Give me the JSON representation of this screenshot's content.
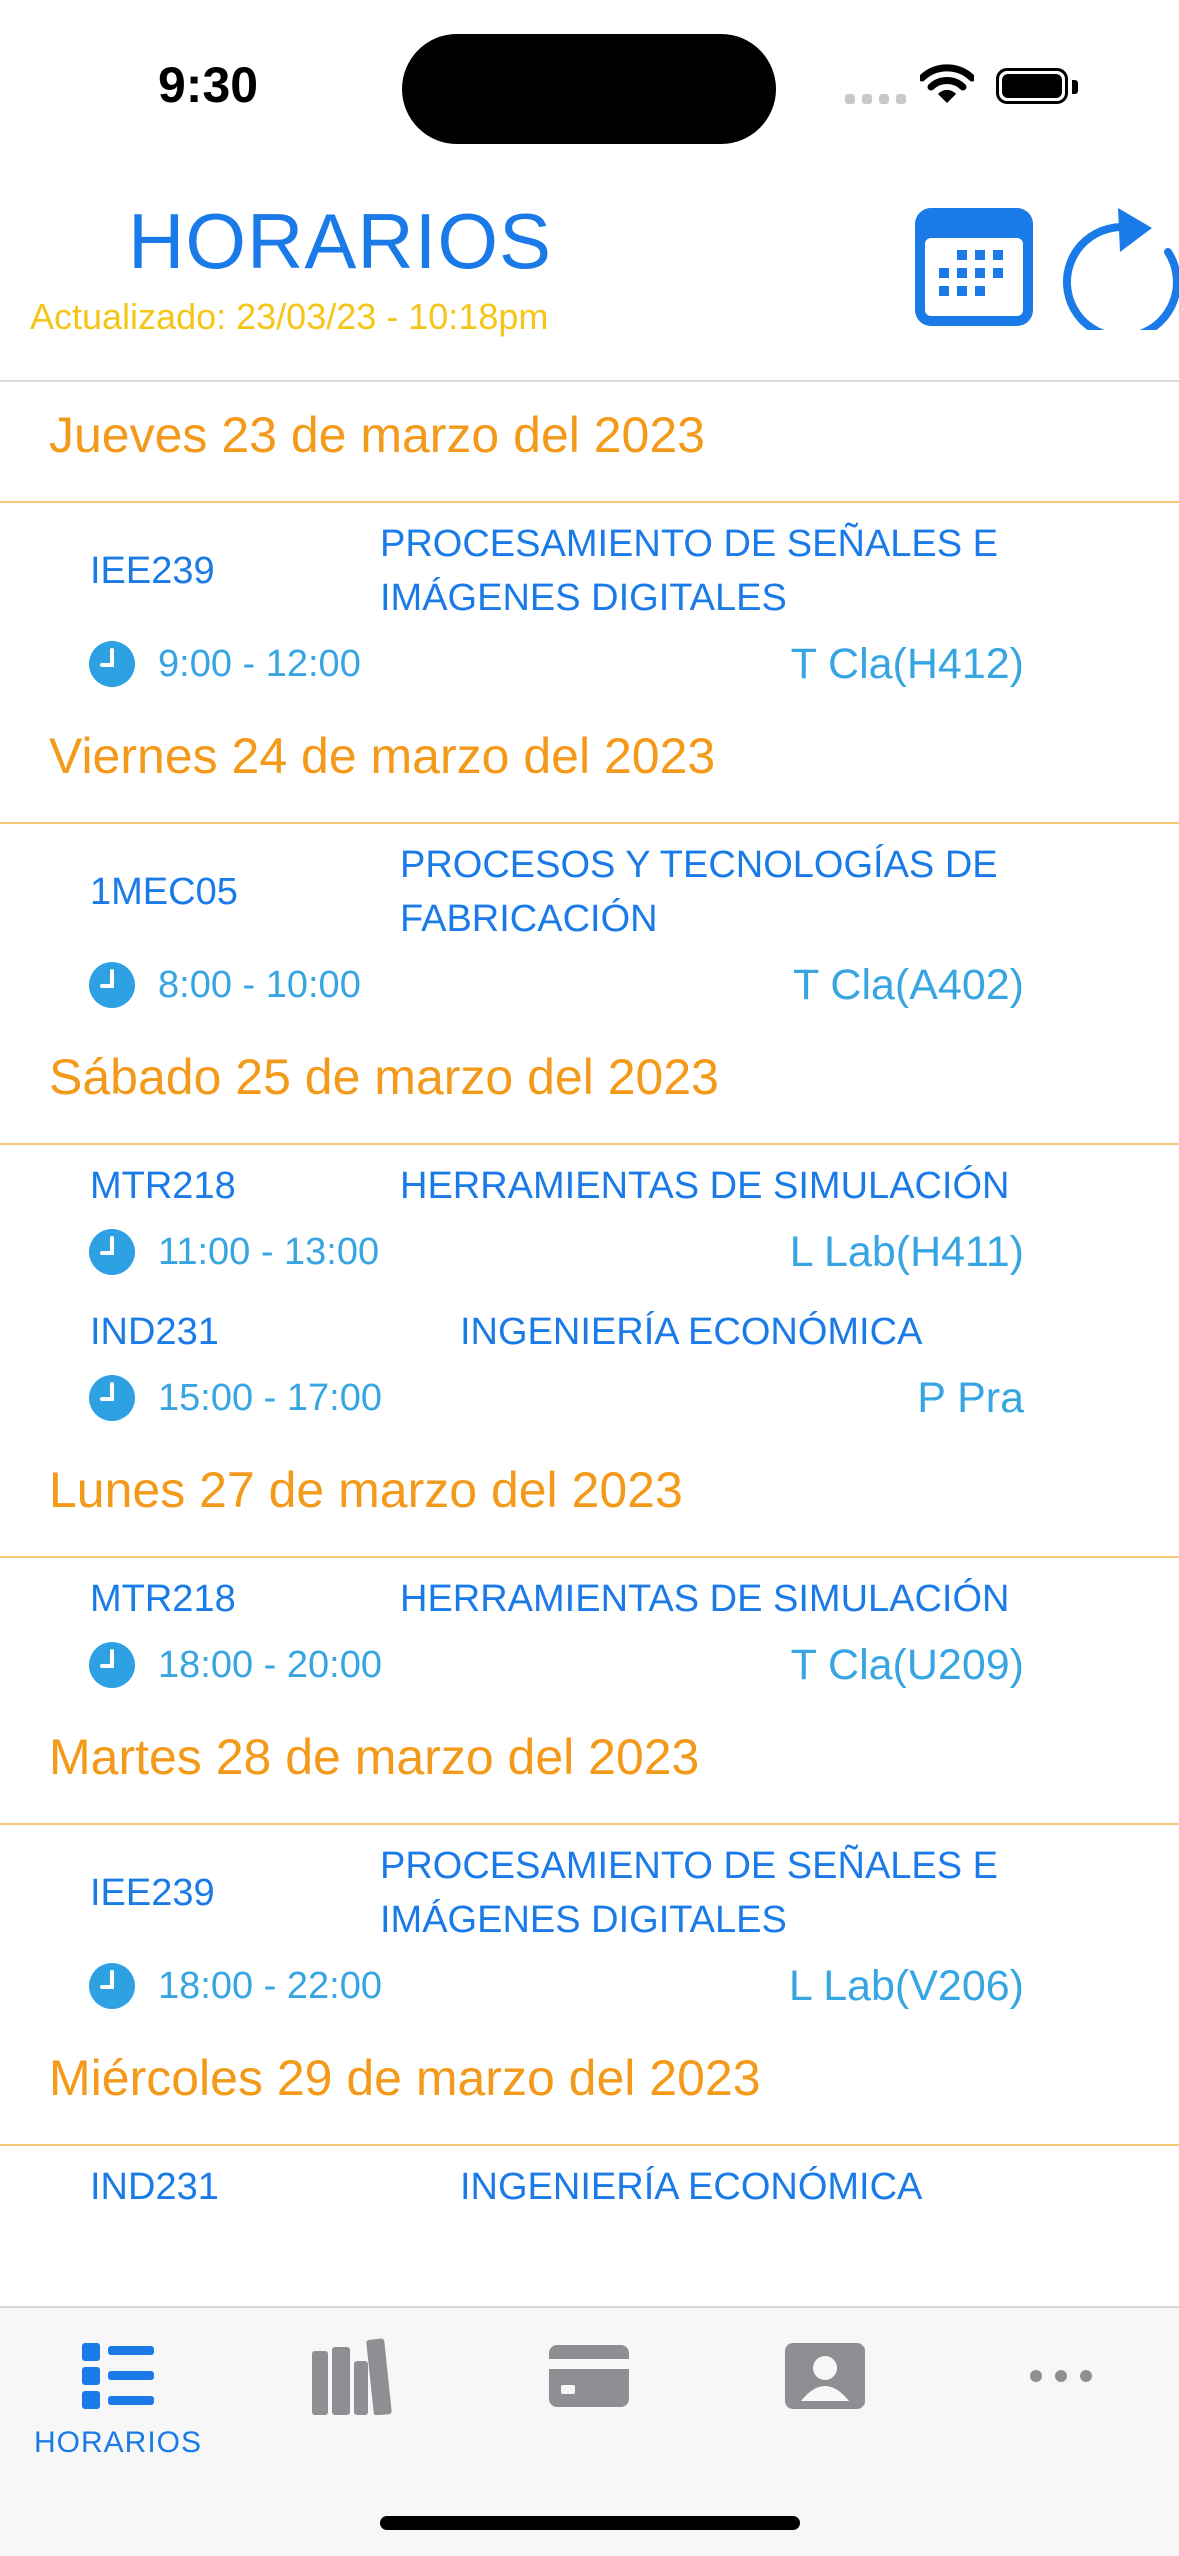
{
  "status_bar": {
    "time": "9:30"
  },
  "header": {
    "title": "HORARIOS",
    "updated": "Actualizado: 23/03/23 - 10:18pm",
    "calendar_icon": "calendar-icon",
    "refresh_icon": "refresh-icon"
  },
  "colors": {
    "accent_blue": "#1a7be8",
    "light_blue": "#36a5e2",
    "orange": "#f39a1b",
    "yellow": "#f5c518"
  },
  "days": [
    {
      "title": "Jueves 23 de marzo del 2023",
      "courses": [
        {
          "code": "IEE239",
          "name": "PROCESAMIENTO DE SEÑALES E IMÁGENES DIGITALES",
          "time": "9:00 - 12:00",
          "room": "T Cla(H412)"
        }
      ]
    },
    {
      "title": "Viernes 24 de marzo del 2023",
      "courses": [
        {
          "code": "1MEC05",
          "name": "PROCESOS Y TECNOLOGÍAS DE FABRICACIÓN",
          "time": "8:00 - 10:00",
          "room": "T Cla(A402)"
        }
      ]
    },
    {
      "title": "Sábado 25 de marzo del 2023",
      "courses": [
        {
          "code": "MTR218",
          "name": "HERRAMIENTAS DE SIMULACIÓN",
          "time": "11:00 - 13:00",
          "room": "L Lab(H411)"
        },
        {
          "code": "IND231",
          "name": "INGENIERÍA ECONÓMICA",
          "time": "15:00 - 17:00",
          "room": "P Pra"
        }
      ]
    },
    {
      "title": "Lunes 27 de marzo del 2023",
      "courses": [
        {
          "code": "MTR218",
          "name": "HERRAMIENTAS DE SIMULACIÓN",
          "time": "18:00 - 20:00",
          "room": "T Cla(U209)"
        }
      ]
    },
    {
      "title": "Martes 28 de marzo del 2023",
      "courses": [
        {
          "code": "IEE239",
          "name": "PROCESAMIENTO DE SEÑALES E IMÁGENES DIGITALES",
          "time": "18:00 - 22:00",
          "room": "L Lab(V206)"
        }
      ]
    },
    {
      "title": "Miércoles 29 de marzo del 2023",
      "courses": [
        {
          "code": "IND231",
          "name": "INGENIERÍA ECONÓMICA",
          "time": "",
          "room": ""
        }
      ]
    }
  ],
  "tabbar": {
    "items": [
      {
        "label": "HORARIOS",
        "icon": "list-icon",
        "active": true
      },
      {
        "label": "",
        "icon": "books-icon",
        "active": false
      },
      {
        "label": "",
        "icon": "card-icon",
        "active": false
      },
      {
        "label": "",
        "icon": "contact-icon",
        "active": false
      },
      {
        "label": "",
        "icon": "more-icon",
        "active": false
      }
    ]
  }
}
